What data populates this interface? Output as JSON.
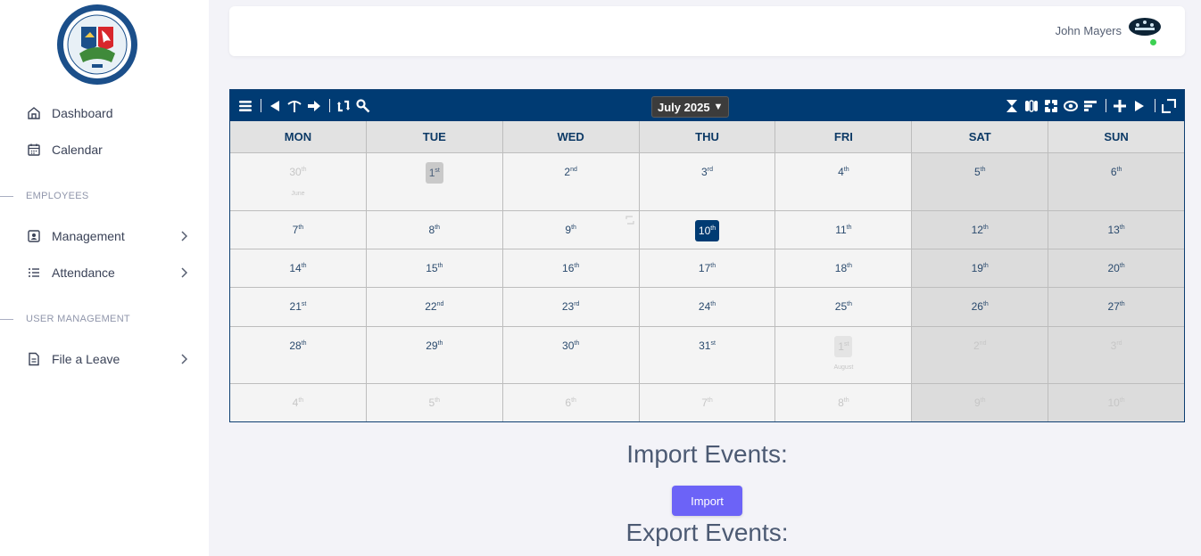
{
  "sidebar": {
    "nav": [
      {
        "label": "Dashboard",
        "icon": "home-icon"
      },
      {
        "label": "Calendar",
        "icon": "calendar-icon"
      }
    ],
    "sections": [
      {
        "title": "EMPLOYEES",
        "items": [
          {
            "label": "Management",
            "icon": "id-card-icon"
          },
          {
            "label": "Attendance",
            "icon": "list-icon"
          }
        ]
      },
      {
        "title": "USER MANAGEMENT",
        "items": [
          {
            "label": "File a Leave",
            "icon": "document-icon"
          }
        ]
      }
    ]
  },
  "topbar": {
    "user_name": "John Mayers",
    "status_color": "#3cd152"
  },
  "calendar": {
    "month_label": "July 2025",
    "accent": "#003b73",
    "weekdays": [
      "MON",
      "TUE",
      "WED",
      "THU",
      "FRI",
      "SAT",
      "SUN"
    ],
    "weeks": [
      [
        {
          "d": "30",
          "s": "th",
          "muted": true,
          "month": "June"
        },
        {
          "d": "1",
          "s": "st",
          "selected": true
        },
        {
          "d": "2",
          "s": "nd"
        },
        {
          "d": "3",
          "s": "rd"
        },
        {
          "d": "4",
          "s": "th"
        },
        {
          "d": "5",
          "s": "th"
        },
        {
          "d": "6",
          "s": "th"
        }
      ],
      [
        {
          "d": "7",
          "s": "th"
        },
        {
          "d": "8",
          "s": "th"
        },
        {
          "d": "9",
          "s": "th",
          "sync": true
        },
        {
          "d": "10",
          "s": "th",
          "today": true
        },
        {
          "d": "11",
          "s": "th"
        },
        {
          "d": "12",
          "s": "th"
        },
        {
          "d": "13",
          "s": "th"
        }
      ],
      [
        {
          "d": "14",
          "s": "th"
        },
        {
          "d": "15",
          "s": "th"
        },
        {
          "d": "16",
          "s": "th"
        },
        {
          "d": "17",
          "s": "th"
        },
        {
          "d": "18",
          "s": "th"
        },
        {
          "d": "19",
          "s": "th"
        },
        {
          "d": "20",
          "s": "th"
        }
      ],
      [
        {
          "d": "21",
          "s": "st"
        },
        {
          "d": "22",
          "s": "nd"
        },
        {
          "d": "23",
          "s": "rd"
        },
        {
          "d": "24",
          "s": "th"
        },
        {
          "d": "25",
          "s": "th"
        },
        {
          "d": "26",
          "s": "th"
        },
        {
          "d": "27",
          "s": "th"
        }
      ],
      [
        {
          "d": "28",
          "s": "th"
        },
        {
          "d": "29",
          "s": "th"
        },
        {
          "d": "30",
          "s": "th"
        },
        {
          "d": "31",
          "s": "st"
        },
        {
          "d": "1",
          "s": "st",
          "muted": true,
          "next": true,
          "month": "August"
        },
        {
          "d": "2",
          "s": "nd",
          "muted": true
        },
        {
          "d": "3",
          "s": "rd",
          "muted": true
        }
      ],
      [
        {
          "d": "4",
          "s": "th",
          "muted": true
        },
        {
          "d": "5",
          "s": "th",
          "muted": true
        },
        {
          "d": "6",
          "s": "th",
          "muted": true
        },
        {
          "d": "7",
          "s": "th",
          "muted": true
        },
        {
          "d": "8",
          "s": "th",
          "muted": true
        },
        {
          "d": "9",
          "s": "th",
          "muted": true
        },
        {
          "d": "10",
          "s": "th",
          "muted": true
        }
      ]
    ]
  },
  "import": {
    "title": "Import Events:",
    "button": "Import"
  },
  "export": {
    "title": "Export Events:"
  }
}
